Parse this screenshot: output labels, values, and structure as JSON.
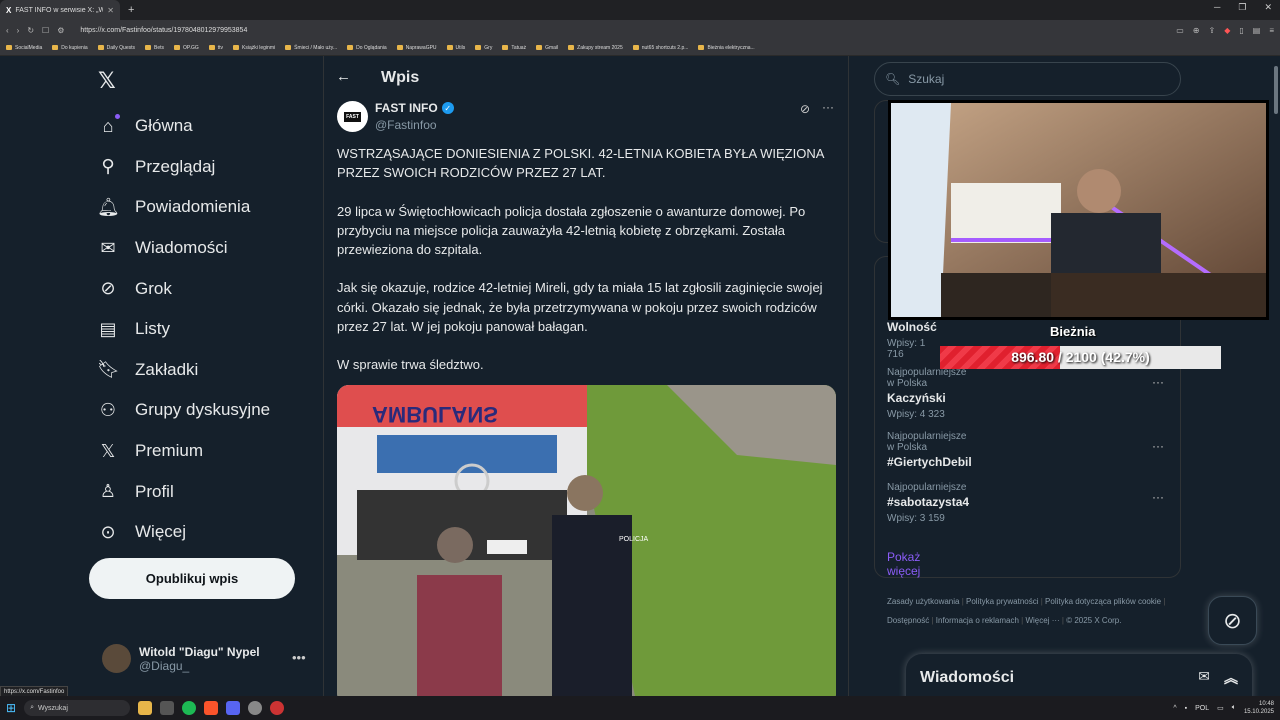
{
  "browser": {
    "tab_title": "FAST INFO w serwisie X: „WSTRZ...",
    "tab_favicon": "X",
    "url": "https://x.com/Fastinfoo/status/1978048012979953854",
    "bookmarks": [
      "SocialMedia",
      "Do kupienia",
      "Daily Quests",
      "Bets",
      "OP.GG",
      "ttv",
      "Książki leginmi",
      "Śmieci / Mało uży...",
      "Do Oglądania",
      "NaprawaGPU",
      "Utils",
      "Gry",
      "Tatuaż",
      "Gmail",
      "Zakupy stream 2025",
      "nut65 shortcuts 2.p...",
      "Bieżnia elektryczna..."
    ],
    "status_url": "https://x.com/Fastinfoo"
  },
  "nav": {
    "items": [
      {
        "label": "Główna",
        "icon": "home-icon"
      },
      {
        "label": "Przeglądaj",
        "icon": "search-icon"
      },
      {
        "label": "Powiadomienia",
        "icon": "bell-icon"
      },
      {
        "label": "Wiadomości",
        "icon": "mail-icon"
      },
      {
        "label": "Grok",
        "icon": "grok-icon"
      },
      {
        "label": "Listy",
        "icon": "list-icon"
      },
      {
        "label": "Zakładki",
        "icon": "bookmark-icon"
      },
      {
        "label": "Grupy dyskusyjne",
        "icon": "groups-icon"
      },
      {
        "label": "Premium",
        "icon": "x-logo-icon"
      },
      {
        "label": "Profil",
        "icon": "person-icon"
      },
      {
        "label": "Więcej",
        "icon": "more-circle-icon"
      }
    ],
    "publish": "Opublikuj wpis"
  },
  "account": {
    "name": "Witold \"Diagu\" Nypel",
    "handle": "@Diagu_"
  },
  "post": {
    "header_title": "Wpis",
    "author": "FAST INFO",
    "avatar_text": "FAST",
    "handle": "@Fastinfoo",
    "paragraphs": [
      "WSTRZĄSAJĄCE DONIESIENIA Z POLSKI. 42-LETNIA KOBIETA BYŁA WIĘZIONA PRZEZ  SWOICH RODZICÓW PRZEZ 27 LAT.",
      "29 lipca w Świętochłowicach policja dostała zgłoszenie o awanturze domowej. Po przybyciu na miejsce policja zauważyła 42-letnią kobietę z obrzękami. Została przewieziona do szpitala.",
      "Jak się okazuje, rodzice 42-letniej Mireli, gdy ta miała 15 lat zgłosili zaginięcie swojej córki. Okazało się jednak, że była przetrzymywana w pokoju przez swoich rodziców przez 27 lat. W jej pokoju panował bałagan.",
      "W sprawie trwa śledztwo."
    ],
    "image": {
      "vehicle_text": "AMBULANS",
      "vest_text": "POLICJA"
    }
  },
  "sidebar": {
    "search_placeholder": "Szukaj",
    "trends": [
      {
        "context": "",
        "title": "Wolność",
        "count": "Wpisy: 1 716"
      },
      {
        "context": "Najpopularniejsze w Polska",
        "title": "Kaczyński",
        "count": "Wpisy: 4 323"
      },
      {
        "context": "Najpopularniejsze w Polska",
        "title": "#GiertychDebil",
        "count": ""
      },
      {
        "context": "Najpopularniejsze",
        "title": "#sabotazysta4",
        "count": "Wpisy: 3 159"
      }
    ],
    "show_more": "Pokaż więcej",
    "footer": [
      "Zasady użytkowania",
      "Polityka prywatności",
      "Polityka dotycząca plików cookie",
      "Dostępność",
      "Informacja o reklamach",
      "Więcej ···",
      "© 2025 X Corp."
    ]
  },
  "overlay": {
    "title": "Bieżnia",
    "progress_current": "896.80",
    "progress_total": "2100",
    "progress_pct": "(42.7%)",
    "progress_fraction": 0.427,
    "fill_color": "#e0202e"
  },
  "messages": {
    "title": "Wiadomości"
  },
  "taskbar": {
    "search": "Wyszukaj",
    "lang": "POL",
    "time": "10:48",
    "date": "15.10.2025"
  },
  "colors": {
    "bg": "#15202b",
    "accent": "#8b5cf6",
    "verified": "#1d9bf0"
  }
}
